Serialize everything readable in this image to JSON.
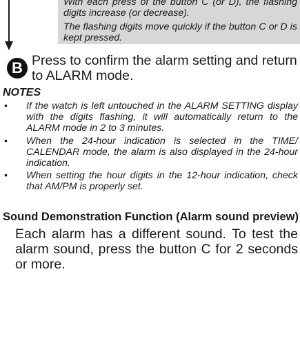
{
  "note_box": {
    "line1": "With each press of the button C (or D), the flashing digits increase (or decrease).",
    "line2": "The flashing digits move quickly if the button C or D is kept pressed."
  },
  "step_b": {
    "badge": "B",
    "text": "Press to confirm the alarm setting and return to ALARM mode."
  },
  "notes": {
    "heading": "NOTES",
    "bullet": "•",
    "items": [
      "If the watch is left untouched in the ALARM SETTING display with the digits flashing, it will automatically return to the ALARM mode in 2 to 3 minutes.",
      "When the 24-hour indication is selected in the TIME/ CALENDAR mode, the alarm is also displayed in the 24-hour indication.",
      "When setting the hour digits in the 12-hour indication, check that AM/PM is properly set."
    ]
  },
  "sound_demo": {
    "heading": "Sound Demonstration Function (Alarm sound preview)",
    "body": "Each alarm has a different sound. To test the alarm sound, press the button C for 2 seconds or more."
  }
}
